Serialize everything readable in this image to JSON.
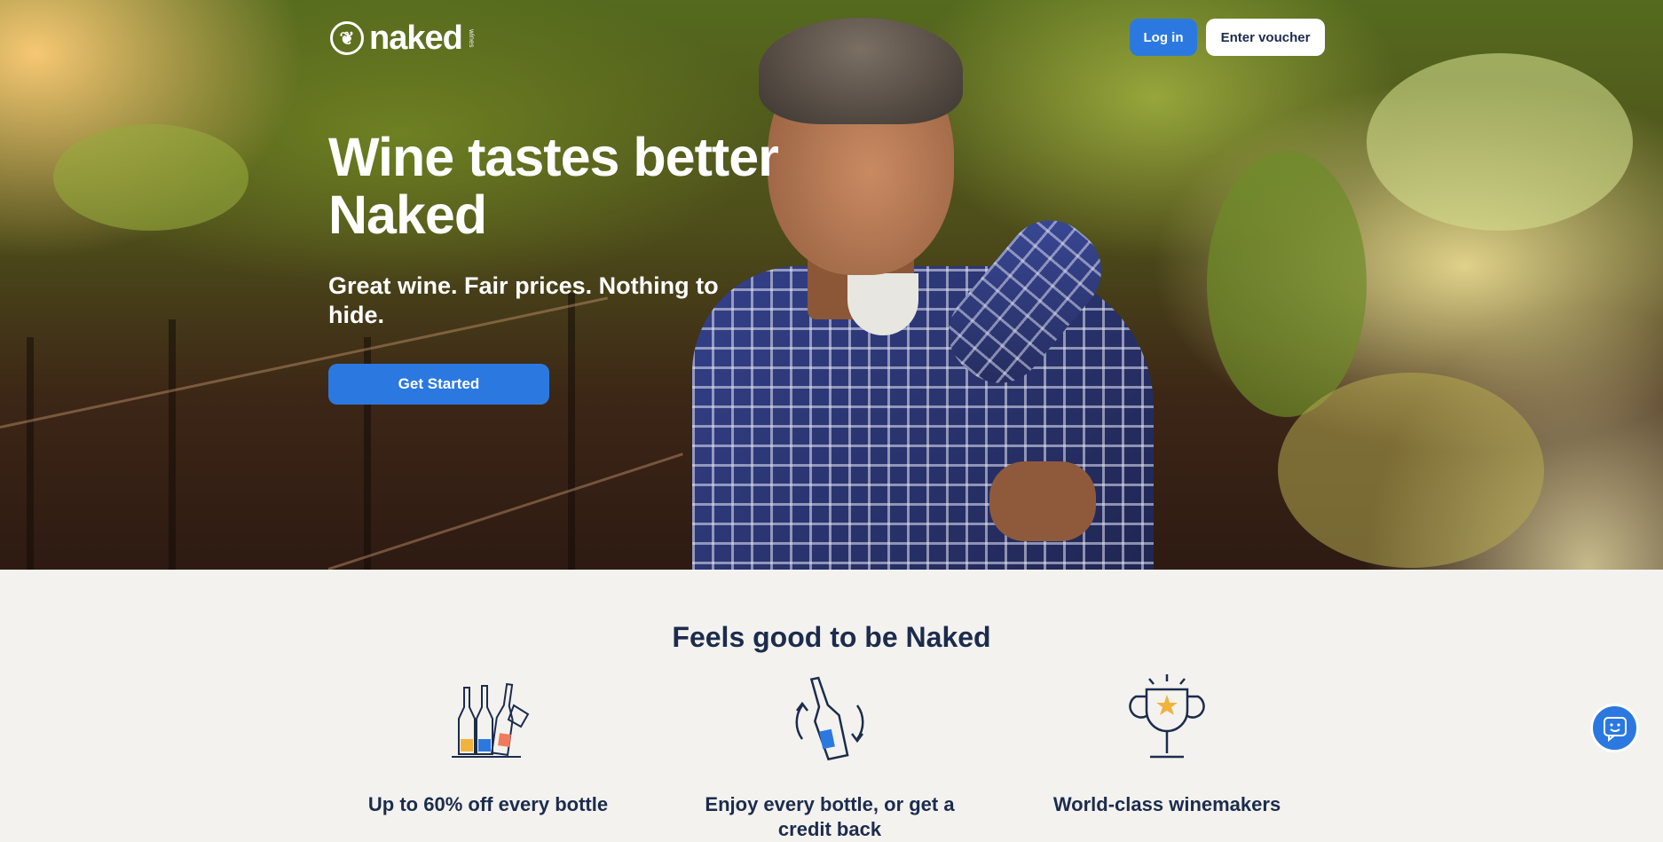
{
  "header": {
    "logo_text": "naked",
    "logo_sub": "wines",
    "login_label": "Log in",
    "voucher_label": "Enter voucher"
  },
  "hero": {
    "title": "Wine tastes better Naked",
    "subtitle": "Great wine. Fair prices. Nothing to hide.",
    "cta_label": "Get Started"
  },
  "features_section": {
    "title": "Feels good to be Naked",
    "items": [
      {
        "icon": "wine-bottles-tag-icon",
        "label": "Up to 60% off every bottle"
      },
      {
        "icon": "bottle-refresh-icon",
        "label": "Enjoy every bottle, or get a credit back"
      },
      {
        "icon": "trophy-star-icon",
        "label": "World-class winemakers"
      }
    ]
  },
  "chat": {
    "icon": "chat-icon"
  },
  "colors": {
    "primary": "#2b79e0",
    "navy": "#1c2c4c",
    "section_bg": "#f3f2ef"
  }
}
